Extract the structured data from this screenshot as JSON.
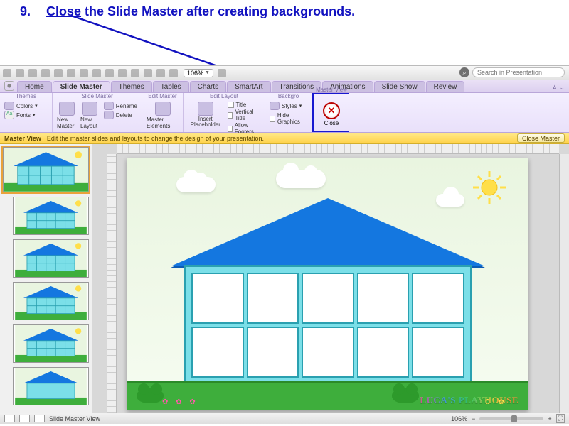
{
  "instruction": {
    "number": "9.",
    "action": "Close",
    "rest": " the Slide Master after creating backgrounds."
  },
  "toolbar": {
    "zoom": "106%",
    "search_placeholder": "Search in Presentation"
  },
  "tabs": [
    "Home",
    "Slide Master",
    "Themes",
    "Tables",
    "Charts",
    "SmartArt",
    "Transitions",
    "Animations",
    "Slide Show",
    "Review"
  ],
  "active_tab": "Slide Master",
  "ribbon": {
    "themes": {
      "label": "Themes",
      "colors": "Colors",
      "fonts": "Fonts"
    },
    "slide_master": {
      "label": "Slide Master",
      "new_master": "New Master",
      "new_layout": "New Layout",
      "rename": "Rename",
      "delete": "Delete"
    },
    "edit_master": {
      "label": "Edit Master",
      "master_elements": "Master Elements"
    },
    "edit_layout": {
      "label": "Edit Layout",
      "insert_placeholder": "Insert Placeholder",
      "title": "Title",
      "vertical_title": "Vertical Title",
      "allow_footers": "Allow Footers"
    },
    "background": {
      "label": "Backgro",
      "styles": "Styles",
      "hide_graphics": "Hide Graphics"
    },
    "master_view": {
      "label": "Master View",
      "close": "Close"
    }
  },
  "yellow_bar": {
    "title": "Master View",
    "message": "Edit the master slides and layouts to change the design of your presentation.",
    "close_btn": "Close Master"
  },
  "slide": {
    "brand": "LUCA'S PLAYHOUSE"
  },
  "status": {
    "mode": "Slide Master View",
    "zoom": "106%"
  }
}
